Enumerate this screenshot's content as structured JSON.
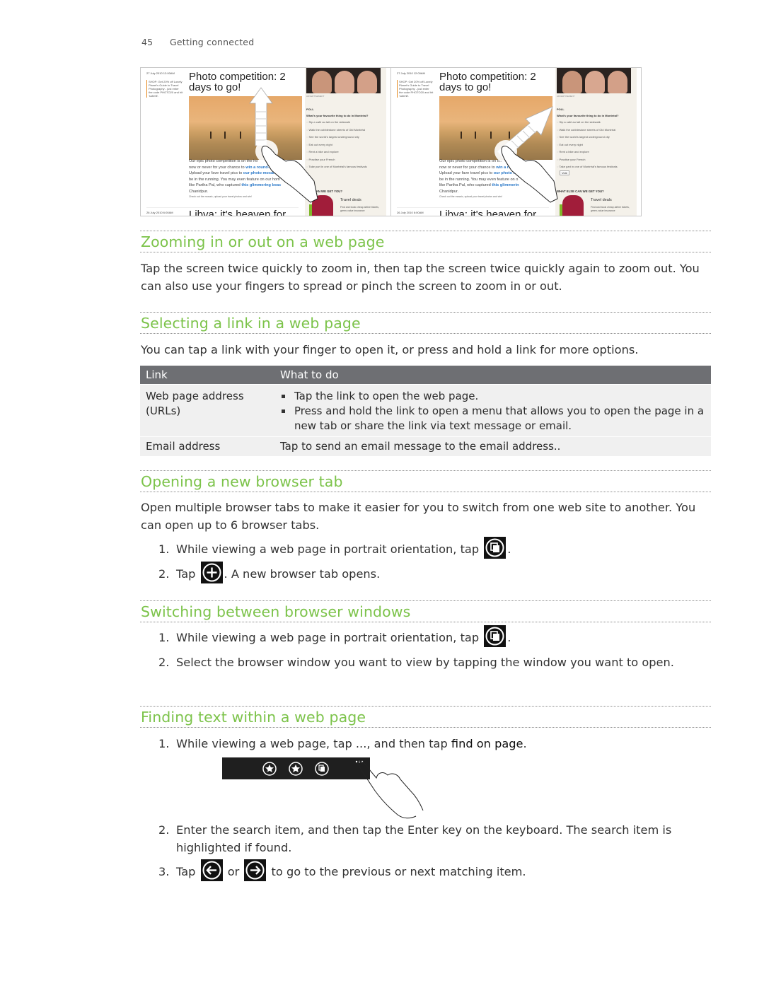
{
  "header": {
    "page_number": "45",
    "chapter": "Getting connected"
  },
  "screenshots": [
    {
      "date": "27 July 2010 12:00AM",
      "promo": "SHOP: Get 20% off Lonely Planet's Guide to Travel Photography - just enter the code PHOTO20 and hit 'submit'.",
      "title": "Photo competition: 2 days to go!",
      "body_pre": "Our epic photo competition is on the ho",
      "body_line2_pre": "now or never for your chance to ",
      "body_line2_link": "win a round-the",
      "body_line3_pre": "Upload your fave travel pics to ",
      "body_line3_link": "our photo mosaic",
      "body_line4": "be in the running. You may even feature on our hom",
      "body_line5_pre": "like Partha Pal, who captured ",
      "body_line5_link": "this glimmering beac",
      "body_line6": "Chanidpur.",
      "more": "Check out the mosaic, upload your travel photos and win!",
      "date2": "26 July 2010 6:00AM",
      "title2": "Libya: it's heaven for",
      "ad_label": "ADVERTISEMENT",
      "poll_heading": "POLL",
      "poll_question": "What's your favourite thing to do in Montréal?",
      "poll_options": [
        "Sip a café au lait on the sidewalk",
        "Walk the cobblestone streets of Old Montréal",
        "See the world's largest underground city",
        "Eat out every night",
        "Rent a bike and explore",
        "Practise your French",
        "Take part in one of Montréal's famous festivals"
      ],
      "vote_label": "",
      "what_else": "...SE CAN WE GET YOU?",
      "travel": "Travel deals",
      "travel_desc": "Find and book cheap airline tickets, green-value insurance"
    },
    {
      "date": "27 July 2010 12:00AM",
      "promo": "SHOP: Get 20% off Lonely Planet's Guide to Travel Photography - just enter the code PHOTO20 and hit 'submit'.",
      "title": "Photo competition: 2 days to go!",
      "body_pre": "Our epic photo competition is on the ho",
      "body_line2_pre": "now or never for your chance to ",
      "body_line2_link": "win a rou",
      "body_line3_pre": "Upload your fave travel pics to ",
      "body_line3_link": "our photo m",
      "body_line4": "be in the running. You may even feature on o",
      "body_line5_pre": "like Partha Pal, who captured ",
      "body_line5_link": "this glimmerin",
      "body_line6": "Chanidpur.",
      "more": "Check out the mosaic, upload your travel photos and win!",
      "date2": "26 July 2010 6:00AM",
      "title2": "Libya: it's heaven for",
      "ad_label": "ADVERTISEMENT",
      "poll_heading": "POLL",
      "poll_question": "What's your favourite thing to do in Montréal?",
      "poll_options": [
        "Sip a café au lait on the sidewalk",
        "Walk the cobblestone streets of Old Montréal",
        "See the world's largest underground city",
        "Eat out every night",
        "Rent a bike and explore",
        "Practise your French",
        "Take part in one of Montréal's famous festivals"
      ],
      "vote_label": "Vote",
      "what_else": "WHAT ELSE CAN WE GET YOU?",
      "travel": "Travel deals",
      "travel_desc": "Find and book cheap airline tickets, green-value insurance"
    }
  ],
  "sections": {
    "zoom": {
      "title": "Zooming in or out on a web page",
      "text": "Tap the screen twice quickly to zoom in, then tap the screen twice quickly again to zoom out. You can also use your fingers to spread or pinch the screen to zoom in or out."
    },
    "select_link": {
      "title": "Selecting a link in a web page",
      "text": "You can tap a link with your finger to open it, or press and hold a link for more options.",
      "table": {
        "headers": [
          "Link",
          "What to do"
        ],
        "rows": [
          {
            "link_line1": "Web page address",
            "link_line2": "(URLs)",
            "bullets": [
              "Tap the link to open the web page.",
              "Press and hold the link to open a menu that allows you to open the page in a new tab or share the link via text message or email."
            ]
          },
          {
            "link": "Email address",
            "action": "Tap to send an email message to the email address.."
          }
        ]
      }
    },
    "new_tab": {
      "title": "Opening a new browser tab",
      "text": "Open multiple browser tabs to make it easier for you to switch from one web site to another. You can open up to 6 browser tabs.",
      "steps": [
        {
          "n": "1.",
          "pre": "While viewing a web page in portrait orientation, tap ",
          "icon": "tabs-icon",
          "post": "."
        },
        {
          "n": "2.",
          "pre": "Tap ",
          "icon": "add-icon",
          "post": ". A new browser tab opens."
        }
      ]
    },
    "switch": {
      "title": "Switching between browser windows",
      "steps": [
        {
          "n": "1.",
          "pre": "While viewing a web page in portrait orientation, tap ",
          "icon": "tabs-icon",
          "post": "."
        },
        {
          "n": "2.",
          "text": "Select the browser window you want to view by tapping the window you want to open."
        }
      ]
    },
    "find": {
      "title": "Finding text within a web page",
      "steps": [
        {
          "n": "1.",
          "pre": "While viewing a web page, tap ..., and then tap ",
          "strong": "find on page",
          "post": "."
        },
        {
          "n": "2.",
          "text": "Enter the search item, and then tap the Enter key on the keyboard. The search item is highlighted if found."
        },
        {
          "n": "3.",
          "pre": "Tap ",
          "mid": " or ",
          "post": " to go to the previous or next matching item."
        }
      ],
      "appbar_icons": [
        "add-favorite-icon",
        "favorites-icon",
        "tabs-icon",
        "more-icon"
      ]
    }
  },
  "colors": {
    "heading_green": "#7cc34a",
    "table_header": "#6e6f73",
    "table_row": "#f0f0f0",
    "icon_bg": "#111111"
  }
}
